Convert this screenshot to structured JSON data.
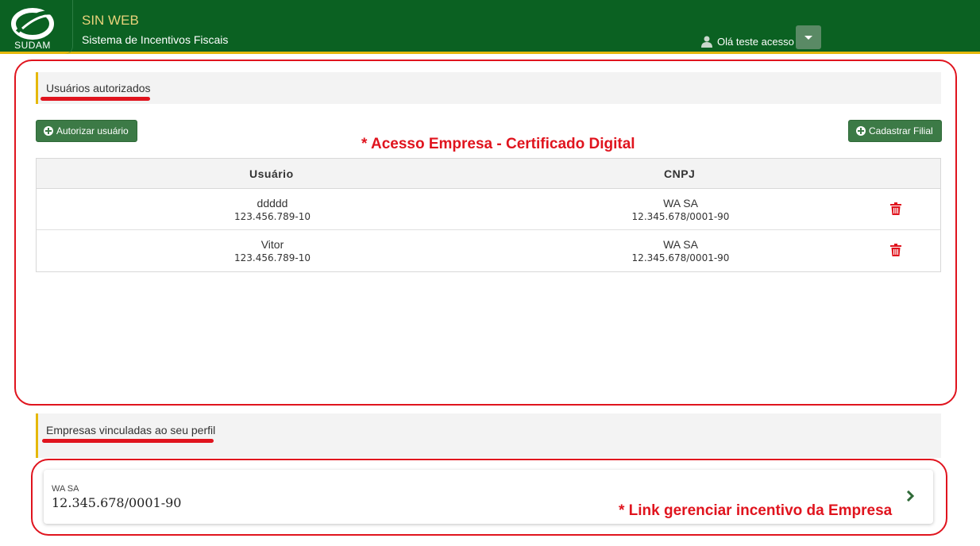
{
  "header": {
    "logo_text": "SUDAM",
    "app_title": "SIN WEB",
    "app_subtitle": "Sistema de Incentivos Fiscais",
    "user_greeting": "Olá teste acesso",
    "brand_color": "#0b6122",
    "accent_color": "#e5b80b"
  },
  "authorized_users": {
    "title": "Usuários autorizados",
    "authorize_button": "Autorizar usuário",
    "register_branch_button": "Cadastrar Filial",
    "annotation": "* Acesso Empresa - Certificado Digital",
    "columns": [
      "Usuário",
      "CNPJ"
    ],
    "rows": [
      {
        "user_name": "ddddd",
        "user_cpf": "123.456.789-10",
        "company": "WA SA",
        "cnpj": "12.345.678/0001-90"
      },
      {
        "user_name": "Vitor",
        "user_cpf": "123.456.789-10",
        "company": "WA SA",
        "cnpj": "12.345.678/0001-90"
      }
    ]
  },
  "linked_companies": {
    "title": "Empresas vinculadas ao seu perfil",
    "annotation": "* Link gerenciar incentivo da Empresa",
    "items": [
      {
        "name": "WA SA",
        "cnpj": "12.345.678/0001-90"
      }
    ]
  },
  "icons": {
    "user": "user-icon",
    "dropdown": "chevron-down-icon",
    "add": "plus-circle-icon",
    "delete": "trash-icon",
    "open": "chevron-right-icon"
  },
  "annotation_color": "#e0141e"
}
